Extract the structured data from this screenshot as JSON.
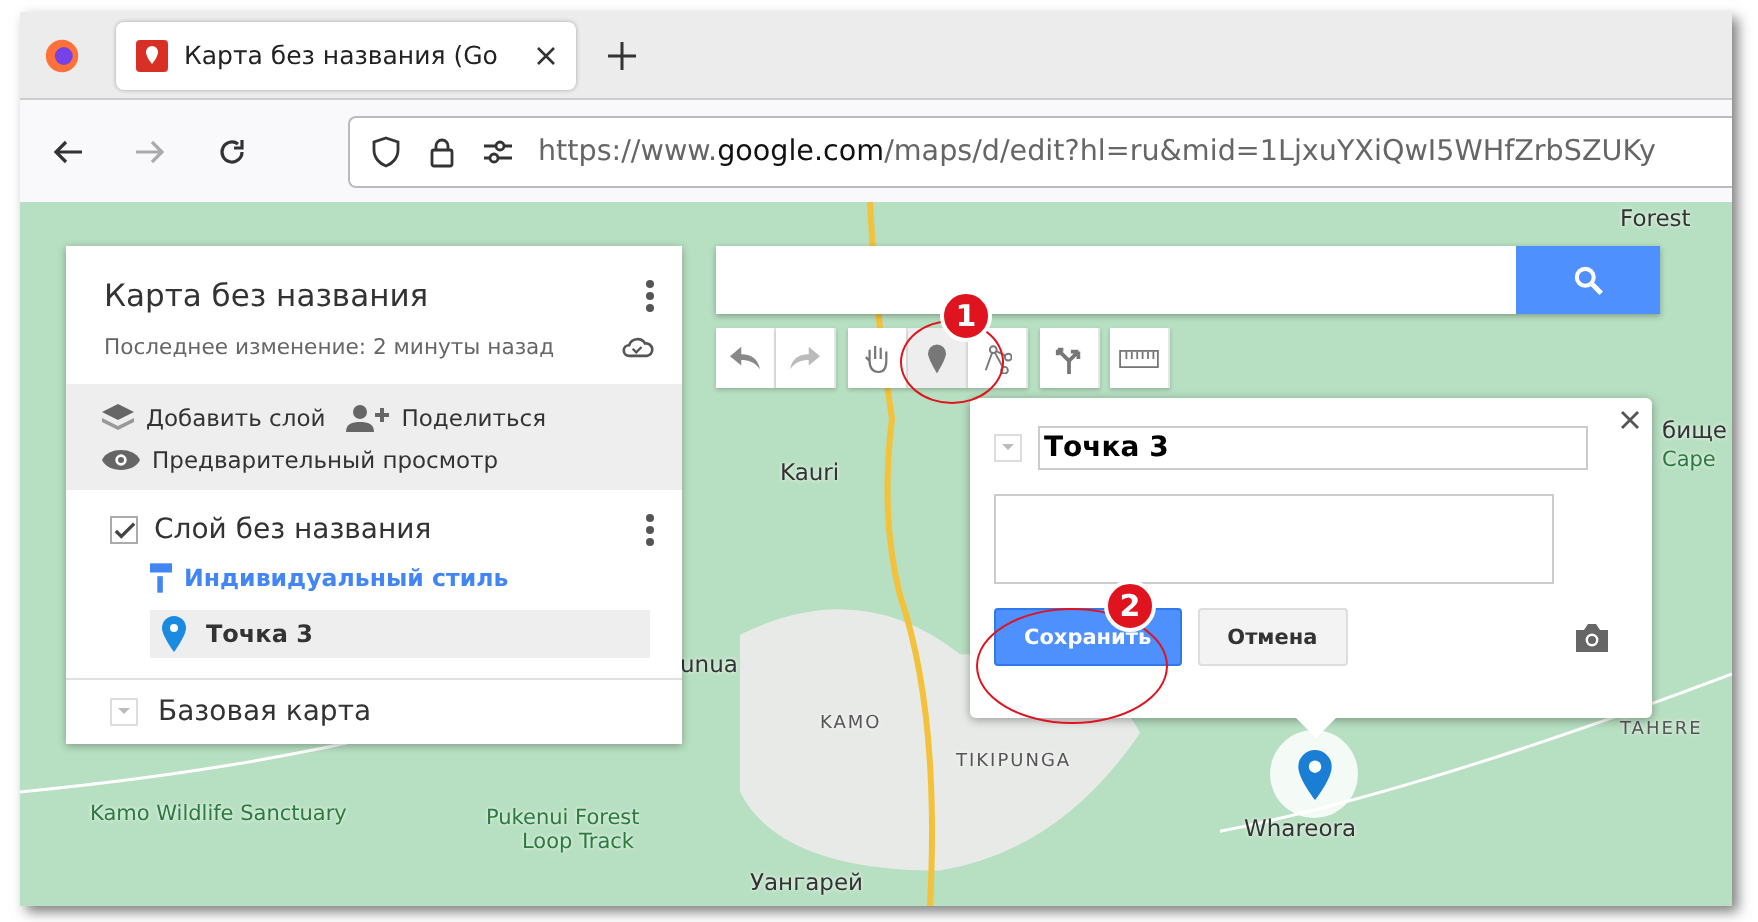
{
  "browser": {
    "tab": {
      "title": "Карта без названия (Go",
      "selected": true
    },
    "url": {
      "prefix": "https://www.",
      "host": "google.com",
      "suffix": "/maps/d/edit?hl=ru&mid=1LjxuYXiQwI5WHfZrbSZUKy"
    },
    "forward_disabled": true
  },
  "map_panel": {
    "title": "Карта без названия",
    "subtitle": "Последнее изменение: 2 минуты назад",
    "actions": [
      {
        "kind": "add-layer",
        "label": "Добавить слой"
      },
      {
        "kind": "share",
        "label": "Поделиться"
      },
      {
        "kind": "preview",
        "label": "Предварительный просмотр"
      }
    ],
    "layer": {
      "name": "Слой без названия",
      "checked": true,
      "style_link": "Индивидуальный стиль",
      "items": [
        {
          "name": "Точка 3",
          "selected": true
        }
      ]
    },
    "base_map": {
      "label": "Базовая карта",
      "expanded": false
    }
  },
  "toolbar": [
    {
      "kind": "undo",
      "selected": false
    },
    {
      "kind": "redo",
      "selected": false
    },
    {
      "kind": "hand",
      "selected": false
    },
    {
      "kind": "marker",
      "selected": true
    },
    {
      "kind": "line",
      "selected": false
    },
    {
      "kind": "route",
      "selected": false
    },
    {
      "kind": "ruler",
      "selected": false
    }
  ],
  "popup": {
    "title_value": "Точка 3",
    "buttons": [
      {
        "kind": "primary",
        "label": "Сохранить"
      },
      {
        "kind": "secondary",
        "label": "Отмена"
      }
    ]
  },
  "map_labels": [
    {
      "text": "Forest",
      "kind": "place"
    },
    {
      "text": "Kauri",
      "kind": "place"
    },
    {
      "text": "unua",
      "kind": "place"
    },
    {
      "text": "KAMO",
      "kind": "district"
    },
    {
      "text": "TIKIPUNGA",
      "kind": "district"
    },
    {
      "text": "Whareora",
      "kind": "place"
    },
    {
      "text": "бище",
      "kind": "place"
    },
    {
      "text": "Cape",
      "kind": "park"
    },
    {
      "text": "TAHERE",
      "kind": "district"
    },
    {
      "text": "Kamo Wildlife Sanctuary",
      "kind": "park"
    },
    {
      "text": "Pukenui Forest",
      "kind": "park"
    },
    {
      "text": "Loop Track",
      "kind": "park"
    },
    {
      "text": "Уангарей",
      "kind": "place"
    }
  ],
  "annotations": [
    {
      "number": "1"
    },
    {
      "number": "2"
    }
  ]
}
